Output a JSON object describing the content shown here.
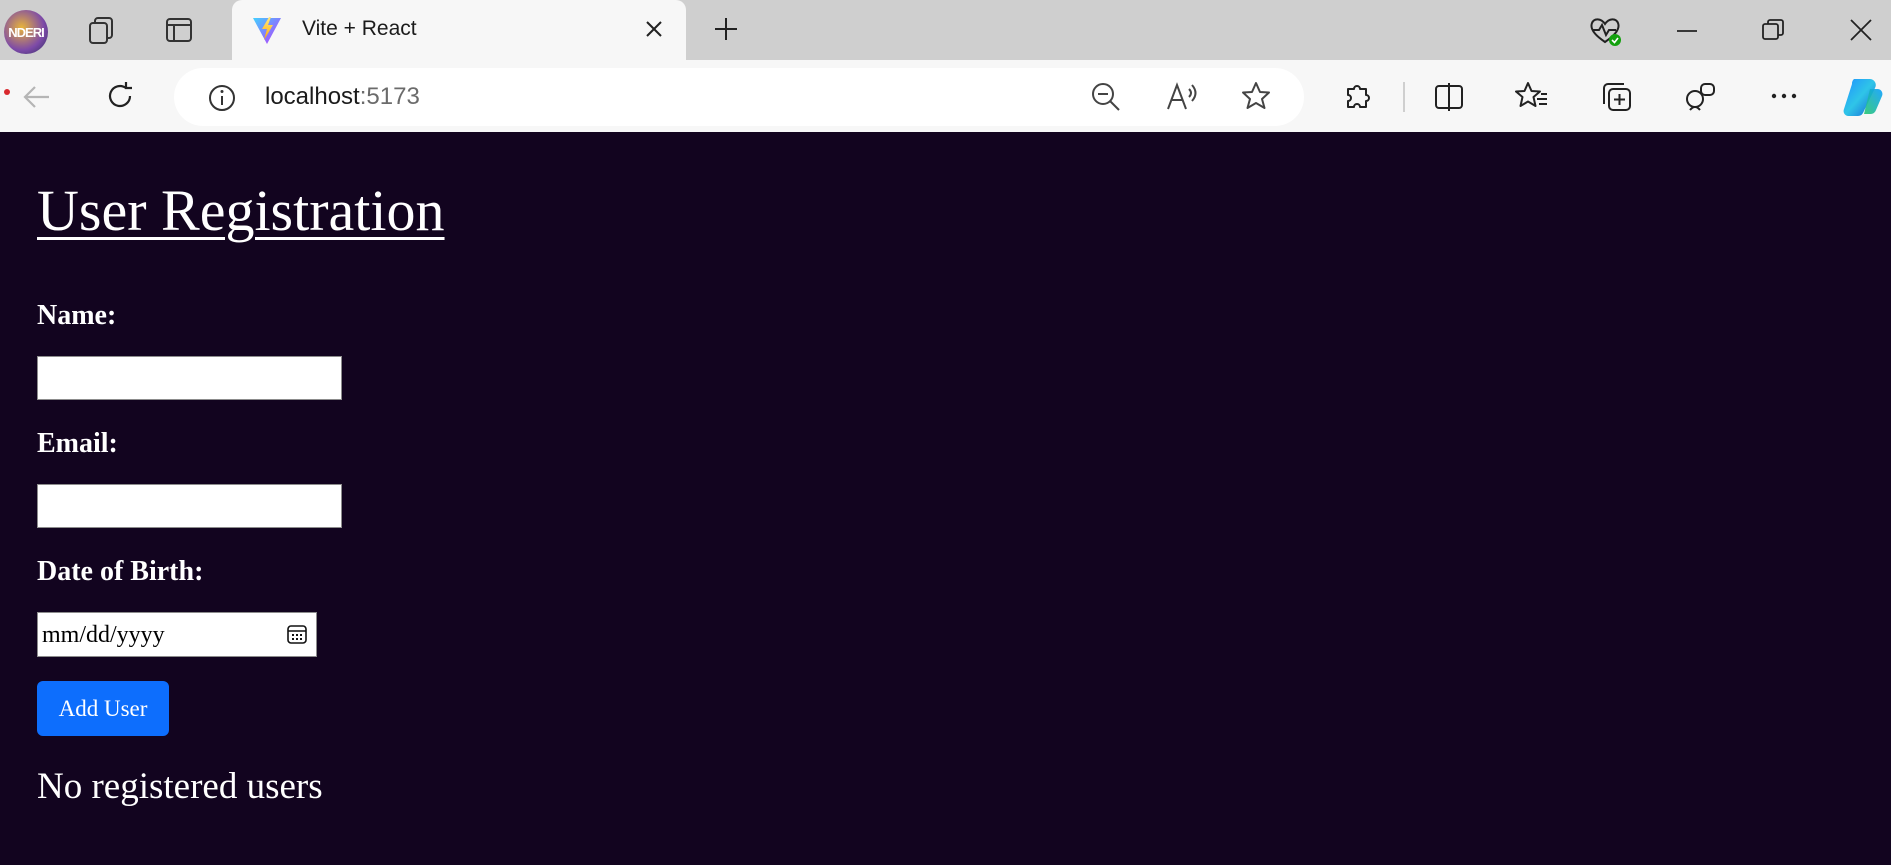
{
  "browser": {
    "tab": {
      "title": "Vite + React"
    },
    "profile_badge": "NDERI",
    "address": {
      "host": "localhost",
      "port": ":5173"
    }
  },
  "icons": [
    "profile-avatar",
    "workspaces-icon",
    "tab-actions-icon",
    "vite-logo-icon",
    "close-icon",
    "new-tab-icon",
    "health-icon",
    "minimize-icon",
    "restore-icon",
    "window-close-icon",
    "back-icon",
    "refresh-icon",
    "site-info-icon",
    "zoom-out-icon",
    "read-aloud-icon",
    "favorite-star-icon",
    "extensions-icon",
    "split-screen-icon",
    "favorites-icon",
    "collections-icon",
    "browser-essentials-icon",
    "more-icon",
    "copilot-icon",
    "calendar-icon"
  ],
  "page": {
    "title": "User Registration",
    "form": {
      "name_label": "Name:",
      "name_value": "",
      "email_label": "Email:",
      "email_value": "",
      "dob_label": "Date of Birth:",
      "dob_placeholder": "mm/dd/yyyy",
      "submit_label": "Add User"
    },
    "empty_message": "No registered users"
  },
  "colors": {
    "page_background": "#12041f",
    "button_primary": "#0d6efd",
    "text": "#ffffff"
  }
}
